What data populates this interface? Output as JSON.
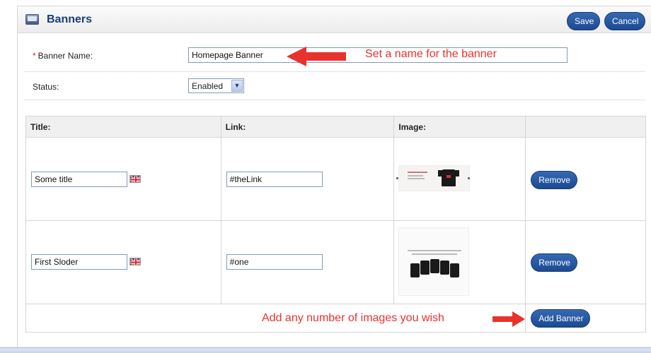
{
  "header": {
    "title": "Banners",
    "icon": "monitor-icon",
    "save_label": "Save",
    "cancel_label": "Cancel"
  },
  "form": {
    "banner_name_required_mark": "*",
    "banner_name_label": "Banner Name:",
    "banner_name_value": "Homepage Banner",
    "status_label": "Status:",
    "status_value": "Enabled"
  },
  "annotations": {
    "name_hint": "Set a name for the banner",
    "add_hint": "Add any number of images you wish"
  },
  "table": {
    "headers": [
      "Title:",
      "Link:",
      "Image:",
      ""
    ],
    "rows": [
      {
        "title": "Some title",
        "link": "#theLink",
        "remove_label": "Remove"
      },
      {
        "title": "First Sloder",
        "link": "#one",
        "remove_label": "Remove"
      }
    ],
    "add_label": "Add Banner"
  },
  "colors": {
    "accent": "#1d4a91",
    "title_color": "#1d3d78",
    "annotation_red": "#e8322e"
  }
}
